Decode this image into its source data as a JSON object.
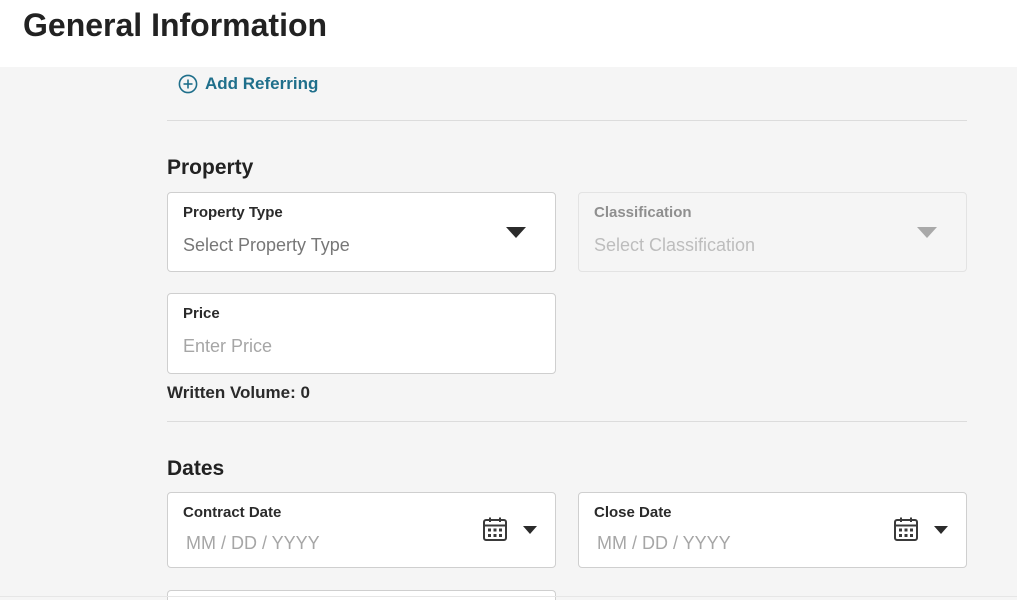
{
  "header": {
    "title": "General Information"
  },
  "referring": {
    "add_label": "Add Referring"
  },
  "property": {
    "section_title": "Property",
    "property_type": {
      "label": "Property Type",
      "placeholder": "Select Property Type"
    },
    "classification": {
      "label": "Classification",
      "placeholder": "Select Classification",
      "disabled": true
    },
    "price": {
      "label": "Price",
      "placeholder": "Enter Price"
    },
    "written_volume": "Written Volume: 0"
  },
  "dates": {
    "section_title": "Dates",
    "contract_date": {
      "label": "Contract Date",
      "placeholder": "MM / DD / YYYY"
    },
    "close_date": {
      "label": "Close Date",
      "placeholder": "MM / DD / YYYY"
    }
  },
  "icons": {
    "add": "plus-circle-icon",
    "dropdown": "caret-down-icon",
    "calendar": "calendar-icon"
  },
  "colors": {
    "accent": "#1f6f8b",
    "text": "#222222",
    "placeholder": "#a6a6a6",
    "background": "#f5f5f5"
  }
}
